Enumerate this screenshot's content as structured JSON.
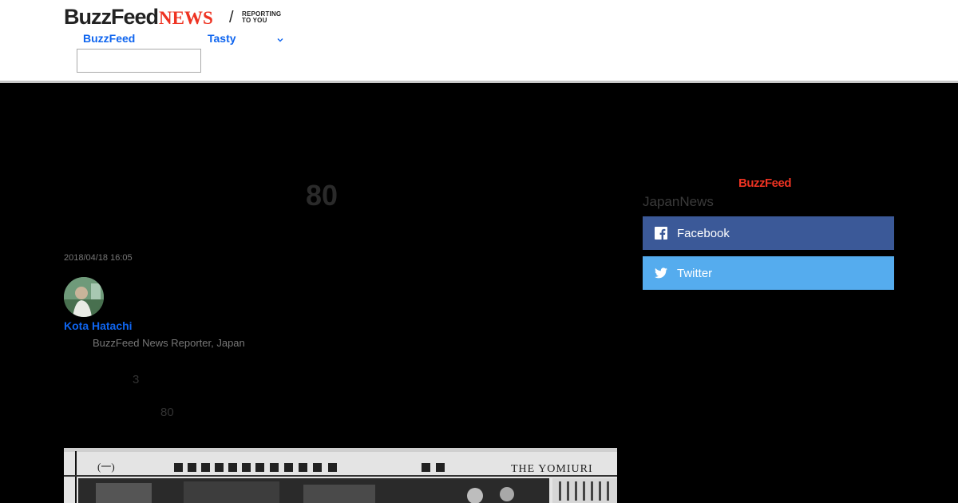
{
  "header": {
    "logo_buzzfeed": "BuzzFeed",
    "logo_news": "NEWS",
    "logo_slash": "/",
    "tagline_line1": "REPORTING",
    "tagline_line2": "TO YOU",
    "nav": [
      {
        "label": "BuzzFeed"
      },
      {
        "label": "Tasty"
      }
    ],
    "search": {
      "value": "",
      "placeholder": ""
    },
    "chevron_icon": "chevron-down-icon"
  },
  "article": {
    "headline": "80",
    "timestamp": "2018/04/18 16:05",
    "author": {
      "name": "Kota Hatachi",
      "role": "BuzzFeed News Reporter, Japan"
    },
    "body": {
      "number_1": "3",
      "number_2": "80"
    }
  },
  "sidebar": {
    "brand": "BuzzFeed",
    "label": "JapanNews",
    "share": {
      "facebook_label": "Facebook",
      "twitter_label": "Twitter"
    }
  },
  "colors": {
    "accent_blue": "#0f65ef",
    "brand_red": "#ee3322",
    "facebook": "#3b5998",
    "twitter": "#55acee",
    "page_background": "#000000"
  }
}
